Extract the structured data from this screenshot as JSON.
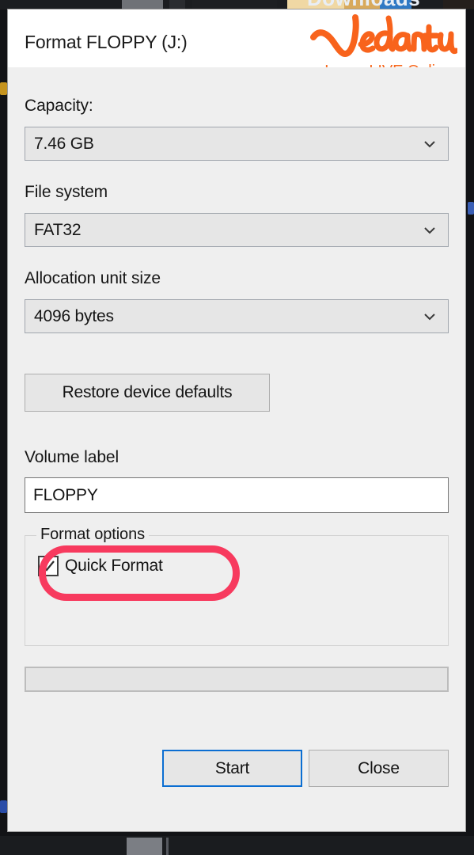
{
  "background": {
    "downloads_label": "Downloads"
  },
  "dialog": {
    "title": "Format FLOPPY (J:)",
    "watermark": {
      "brand": "Vedantu",
      "tagline": "Learn LIVE Online",
      "brand_color": "#f86a20"
    },
    "fields": {
      "capacity": {
        "label": "Capacity:",
        "value": "7.46 GB",
        "arrow_icon": "chevron-down-icon"
      },
      "file_system": {
        "label": "File system",
        "value": "FAT32",
        "arrow_icon": "chevron-down-icon"
      },
      "allocation_unit_size": {
        "label": "Allocation unit size",
        "value": "4096 bytes",
        "arrow_icon": "chevron-down-icon"
      },
      "volume_label": {
        "label": "Volume label",
        "value": "FLOPPY",
        "placeholder": ""
      }
    },
    "restore_defaults_label": "Restore device defaults",
    "format_options": {
      "legend": "Format options",
      "quick_format": {
        "label": "Quick Format",
        "checked": true,
        "check_icon": "checkmark-icon"
      }
    },
    "progress": {
      "percent": 0
    },
    "buttons": {
      "start": "Start",
      "close": "Close"
    }
  },
  "annotation": {
    "shape": "rounded-rectangle",
    "color": "#f73a5e",
    "target": "Quick Format"
  }
}
